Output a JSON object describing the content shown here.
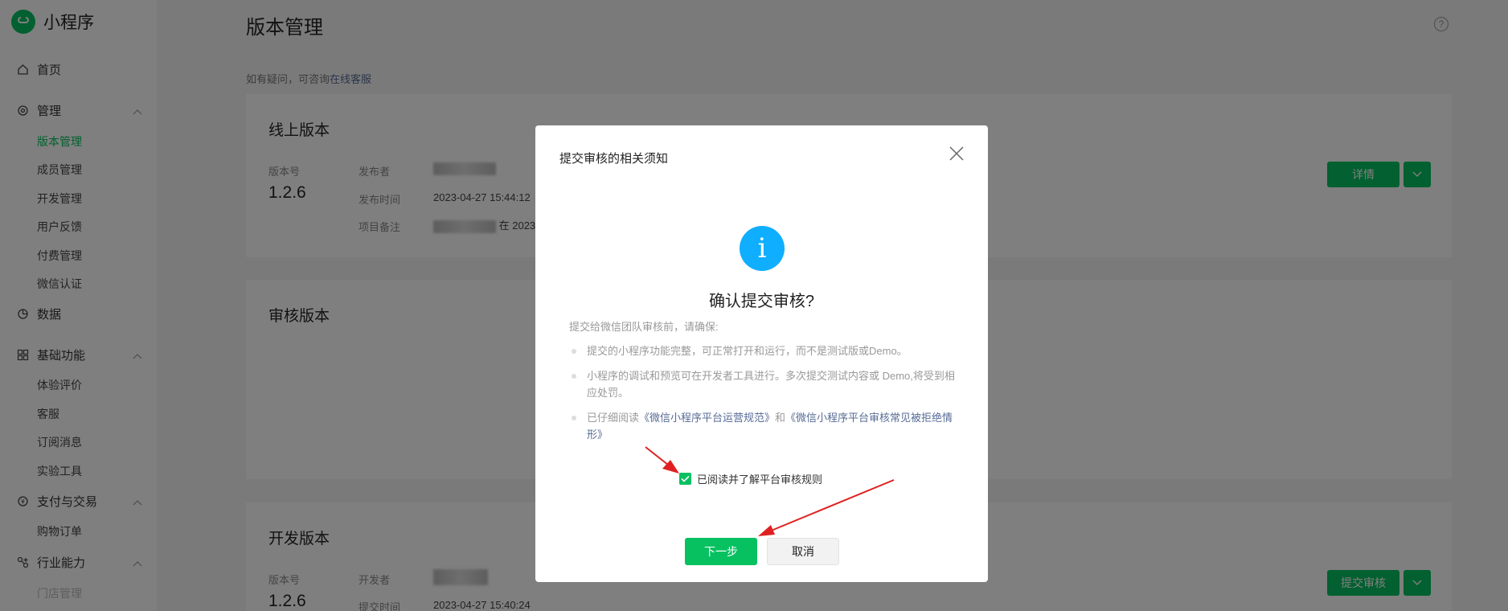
{
  "app": {
    "name": "小程序"
  },
  "sidebar": {
    "home": "首页",
    "manage": "管理",
    "manage_items": [
      "版本管理",
      "成员管理",
      "开发管理",
      "用户反馈",
      "付费管理",
      "微信认证"
    ],
    "data": "数据",
    "basic": "基础功能",
    "basic_items": [
      "体验评价",
      "客服",
      "订阅消息",
      "实验工具"
    ],
    "pay": "支付与交易",
    "pay_items": [
      "购物订单"
    ],
    "industry": "行业能力",
    "industry_items": [
      "门店管理"
    ]
  },
  "page": {
    "title": "版本管理",
    "hint_prefix": "如有疑问，可咨询",
    "hint_link": "在线客服"
  },
  "online": {
    "title": "线上版本",
    "version_label": "版本号",
    "version": "1.2.6",
    "publisher_label": "发布者",
    "publisher_tail": "",
    "time_label": "发布时间",
    "time": "2023-04-27 15:44:12",
    "note_label": "项目备注",
    "note_tail": "在 2023",
    "detail_button": "详情"
  },
  "review": {
    "title": "审核版本"
  },
  "dev": {
    "title": "开发版本",
    "version_label": "版本号",
    "version": "1.2.6",
    "developer_label": "开发者",
    "time_label": "提交时间",
    "time": "2023-04-27 15:40:24",
    "submit_button": "提交审核"
  },
  "modal": {
    "title": "提交审核的相关须知",
    "confirm": "确认提交审核?",
    "intro": "提交给微信团队审核前，请确保:",
    "bullet1": "提交的小程序功能完整，可正常打开和运行，而不是测试版或Demo。",
    "bullet2": "小程序的调试和预览可在开发者工具进行。多次提交测试内容或 Demo,将受到相应处罚。",
    "bullet3_prefix": "已仔细阅读",
    "bullet3_link1": "《微信小程序平台运营规范》",
    "bullet3_mid": "和",
    "bullet3_link2": "《微信小程序平台审核常见被拒绝情形》",
    "agree": "已阅读并了解平台审核规则",
    "next": "下一步",
    "cancel": "取消"
  },
  "colors": {
    "accent": "#07c160",
    "info": "#10aeff",
    "link": "#576b95",
    "annotation": "#e02020"
  }
}
